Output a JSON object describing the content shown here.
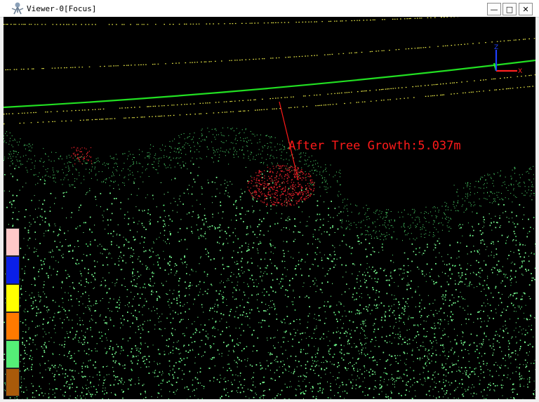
{
  "window": {
    "title": "Viewer-0[Focus]",
    "minimize_label": "—",
    "maximize_label": "□",
    "close_label": "✕"
  },
  "viewport": {
    "background": "#000000",
    "measurement_label": "After Tree Growth:5.037m",
    "measurement_color": "#ff1a1a",
    "powerline_color": "#22e022",
    "wire_color": "#f2f24a",
    "vegetation_color": "#55ee77",
    "encroachment_color": "#e0202a",
    "axis_gizmo": {
      "x_label": "X",
      "z_label": "Z",
      "x_color": "#ff2020",
      "y_color": "#20ff20",
      "z_color": "#2040ff"
    }
  },
  "legend": {
    "colors": [
      "#ffc8c8",
      "#0a1fe8",
      "#ffff00",
      "#ff7a00",
      "#55ee77",
      "#a95a0a"
    ]
  }
}
